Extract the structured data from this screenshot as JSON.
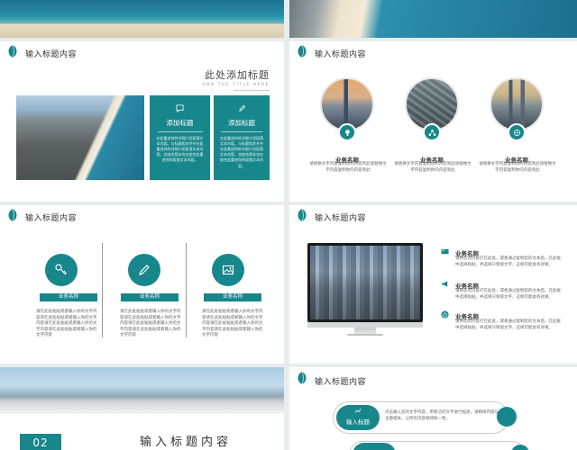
{
  "colors": {
    "accent": "#17878c",
    "background": "#e9eced"
  },
  "slide1": {
    "title": "输入标题内容",
    "heading": "此处添加标题",
    "subheading": "ADD THE TITLE HERE",
    "cards": [
      {
        "icon": "message-icon",
        "title": "添加标题",
        "text": "在此重述你的详细介绍段落文本内容。与标题相关并并在此重述你的详细介绍段落文本内容，也结合简本也在结合此重述你的段落文本内容。"
      },
      {
        "icon": "pencil-icon",
        "title": "添加标题",
        "text": "在此重述你的详细介绍段落文本内容。与标题相关并并在此重述你的详细介绍段落文本内容，也结合简本也在结合此重述你的段落文本内容。"
      }
    ]
  },
  "slide2": {
    "title": "输入标题内容",
    "items": [
      {
        "icon": "lightbulb-icon",
        "name": "业务名称",
        "text": "请替换文字内容复制你的内容到此请替换文字内容复制你的内容到此"
      },
      {
        "icon": "network-icon",
        "name": "业务名称",
        "text": "请替换文字内容复制你的内容到此请替换文字内容复制你的内容到此"
      },
      {
        "icon": "globe-icon",
        "name": "业务名称",
        "text": "请替换文字内容复制你的内容到此请替换文字内容复制你的内容到此"
      }
    ]
  },
  "slide3": {
    "title": "输入标题内容",
    "columns": [
      {
        "icon": "key-icon",
        "label": "业务名称",
        "text": "请在此处粘贴或者输入你的文字内容请在此处粘贴或者输入你的文字内容请在此处粘贴或者输入你的文字内容请在此处粘贴或者输入你的文字内容"
      },
      {
        "icon": "pencil-icon",
        "label": "业务名称",
        "text": "请在此处粘贴或者输入你的文字内容请在此处粘贴或者输入你的文字内容请在此处粘贴或者输入你的文字内容请在此处粘贴或者输入你的文字内容"
      },
      {
        "icon": "image-icon",
        "label": "业务名称",
        "text": "请在此处粘贴或者输入你的文字内容请在此处粘贴或者输入你的文字内容请在此处粘贴或者输入你的文字内容请在此处粘贴或者输入你的文字内容"
      }
    ]
  },
  "slide4": {
    "title": "输入标题内容",
    "items": [
      {
        "icon": "card-icon",
        "name": "业务名称",
        "text": "请将您的内容打在此处，或者通过复制您的文本后，在此框中选择粘贴，并选择只保留文字，这样可能会有效果。"
      },
      {
        "icon": "megaphone-icon",
        "name": "业务名称",
        "text": "请将您的内容打在此处，或者通过复制您的文本后，在此框中选择粘贴，并选择只保留文字，这样可能会有效果。"
      },
      {
        "icon": "power-icon",
        "name": "业务名称",
        "text": "请将您的内容打在此处，或者通过复制您的文本后，在此框中选择粘贴，并选择只保留文字，这样可能会有效果。"
      }
    ]
  },
  "slide5": {
    "number": "02",
    "title": "输入标题内容"
  },
  "slide6": {
    "title": "输入标题内容",
    "rows": [
      {
        "icon": "chart-icon",
        "label": "输入标题",
        "text": "点击输入您的文字内容，用简洁的文字进行描述。请精简内容与主题相关，让所有内容保持统一性。"
      }
    ]
  }
}
